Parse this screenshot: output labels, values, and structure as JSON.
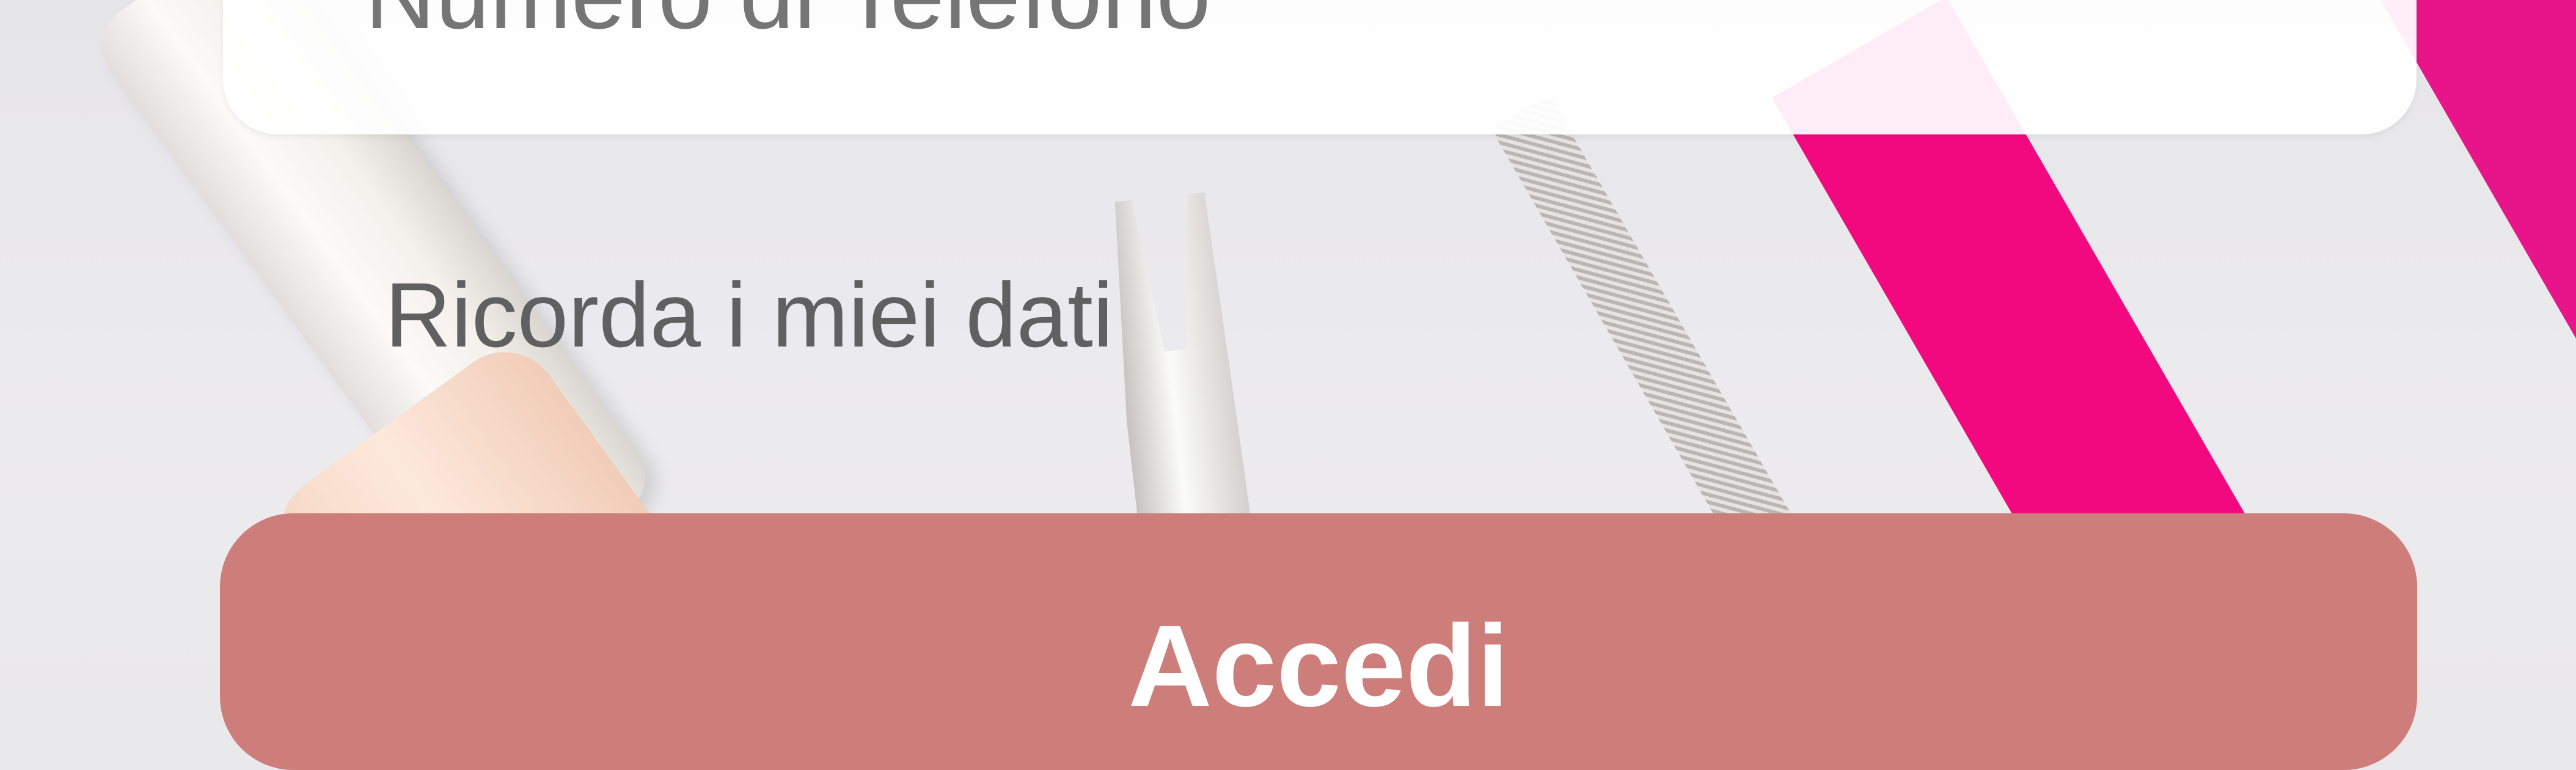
{
  "form": {
    "phone_placeholder": "Numero di Telefono",
    "remember_label": "Ricorda i miei dati",
    "login_label": "Accedi"
  },
  "colors": {
    "button": "#cd7e7b",
    "placeholder": "#9aa0a9",
    "label": "#606060"
  }
}
